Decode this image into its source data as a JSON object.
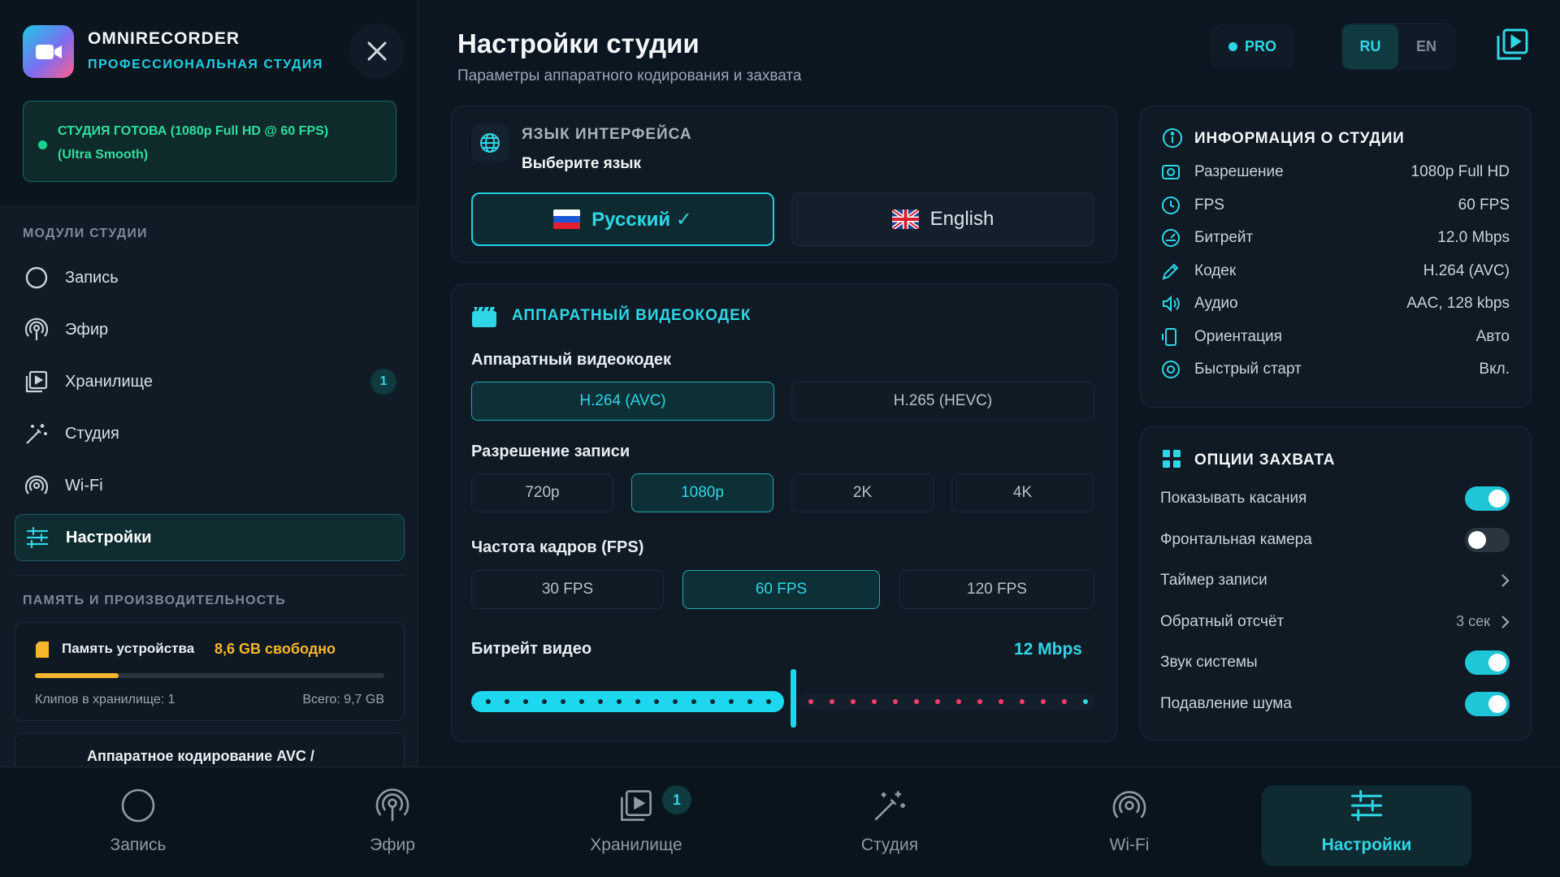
{
  "app": {
    "name": "OMNIRECORDER",
    "subtitle": "ПРОФЕССИОНАЛЬНАЯ СТУДИЯ"
  },
  "status": {
    "line1": "СТУДИЯ ГОТОВА (1080p Full HD @ 60 FPS)",
    "line2": "(Ultra Smooth)",
    "color": "#2ddf9e"
  },
  "sidebar": {
    "modules_title": "МОДУЛИ СТУДИИ",
    "items": [
      {
        "label": "Запись",
        "icon": "record-circle-icon"
      },
      {
        "label": "Эфир",
        "icon": "broadcast-icon"
      },
      {
        "label": "Хранилище",
        "icon": "storage-play-icon",
        "badge": "1"
      },
      {
        "label": "Студия",
        "icon": "magic-wand-icon"
      },
      {
        "label": "Wi-Fi",
        "icon": "wifi-icon"
      },
      {
        "label": "Настройки",
        "icon": "sliders-icon",
        "active": true
      }
    ],
    "memory_title": "ПАМЯТЬ И ПРОИЗВОДИТЕЛЬНОСТЬ",
    "memory": {
      "label": "Память устройства",
      "value": "8,6 GB свободно",
      "clips": "Клипов в хранилище: 1",
      "total": "Всего: 9,7 GB",
      "used_fraction": 0.24
    },
    "encoding_text": "Аппаратное кодирование AVC /"
  },
  "header": {
    "title": "Настройки студии",
    "subtitle": "Параметры аппаратного кодирования и захвата",
    "pro": "PRO",
    "lang_ru": "RU",
    "lang_en": "EN"
  },
  "language": {
    "header": "ЯЗЫК ИНТЕРФЕЙСА",
    "sub": "Выберите язык",
    "ru": "Русский ✓",
    "en": "English"
  },
  "codec": {
    "header": "АППАРАТНЫЙ ВИДЕОКОДЕК",
    "codec_label": "Аппаратный видеокодек",
    "codecs": [
      "H.264 (AVC)",
      "H.265 (HEVC)"
    ],
    "resolution_label": "Разрешение записи",
    "resolutions": [
      "720p",
      "1080p",
      "2K",
      "4K"
    ],
    "fps_label": "Частота кадров (FPS)",
    "fps": [
      "30 FPS",
      "60 FPS",
      "120 FPS"
    ],
    "bitrate_label": "Битрейт видео",
    "bitrate_value": "12 Mbps",
    "bitrate_fraction": 0.51
  },
  "info": {
    "header": "ИНФОРМАЦИЯ О СТУДИИ",
    "rows": [
      {
        "k": "Разрешение",
        "v": "1080p Full HD",
        "icon": "resolution-icon"
      },
      {
        "k": "FPS",
        "v": "60 FPS",
        "icon": "clock-icon"
      },
      {
        "k": "Битрейт",
        "v": "12.0 Mbps",
        "icon": "gauge-icon"
      },
      {
        "k": "Кодек",
        "v": "H.264 (AVC)",
        "icon": "codec-edit-icon"
      },
      {
        "k": "Аудио",
        "v": "AAC, 128 kbps",
        "icon": "audio-icon"
      },
      {
        "k": "Ориентация",
        "v": "Авто",
        "icon": "rotate-icon"
      },
      {
        "k": "Быстрый старт",
        "v": "Вкл.",
        "icon": "quickstart-icon"
      }
    ]
  },
  "capture": {
    "header": "ОПЦИИ ЗАХВАТА",
    "rows": [
      {
        "k": "Показывать касания",
        "type": "toggle",
        "on": true
      },
      {
        "k": "Фронтальная камера",
        "type": "toggle",
        "on": false
      },
      {
        "k": "Таймер записи",
        "type": "link",
        "v": ""
      },
      {
        "k": "Обратный отсчёт",
        "type": "link",
        "v": "3 сек"
      },
      {
        "k": "Звук системы",
        "type": "toggle",
        "on": true
      },
      {
        "k": "Подавление шума",
        "type": "toggle",
        "on": true
      }
    ]
  },
  "bottom_nav": [
    {
      "label": "Запись"
    },
    {
      "label": "Эфир"
    },
    {
      "label": "Хранилище",
      "badge": "1"
    },
    {
      "label": "Студия"
    },
    {
      "label": "Wi-Fi"
    },
    {
      "label": "Настройки",
      "active": true
    }
  ],
  "colors": {
    "accent": "#22cfe3",
    "bg": "#0c1620",
    "warning": "#f6b62b",
    "bitrate_dots": "#ff3b6b"
  }
}
